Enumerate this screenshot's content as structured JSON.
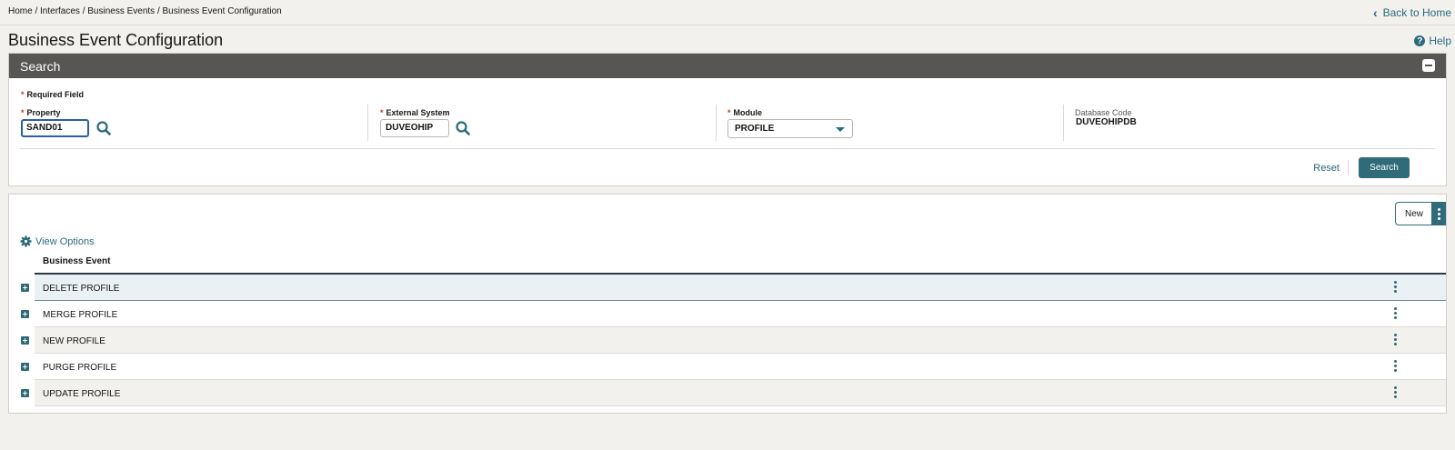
{
  "breadcrumb": "Home / Interfaces / Business Events / Business Event Configuration",
  "back_to_home": "Back to Home",
  "page_title": "Business Event Configuration",
  "help_label": "Help",
  "search_panel": {
    "title": "Search",
    "required_note": "Required Field",
    "required_star": "*",
    "property": {
      "label": "Property",
      "value": "SAND01"
    },
    "external_system": {
      "label": "External System",
      "value": "DUVEOHIP"
    },
    "module": {
      "label": "Module",
      "value": "PROFILE"
    },
    "database_code": {
      "label": "Database Code",
      "value": "DUVEOHIPDB"
    },
    "reset_label": "Reset",
    "search_button": "Search"
  },
  "results": {
    "new_button": "New",
    "view_options": "View Options",
    "column_header": "Business Event",
    "rows": [
      "DELETE PROFILE",
      "MERGE PROFILE",
      "NEW PROFILE",
      "PURGE PROFILE",
      "UPDATE PROFILE"
    ]
  },
  "colors": {
    "accent": "#2f6b78",
    "panel_header": "#575655",
    "required": "#c0392b"
  }
}
